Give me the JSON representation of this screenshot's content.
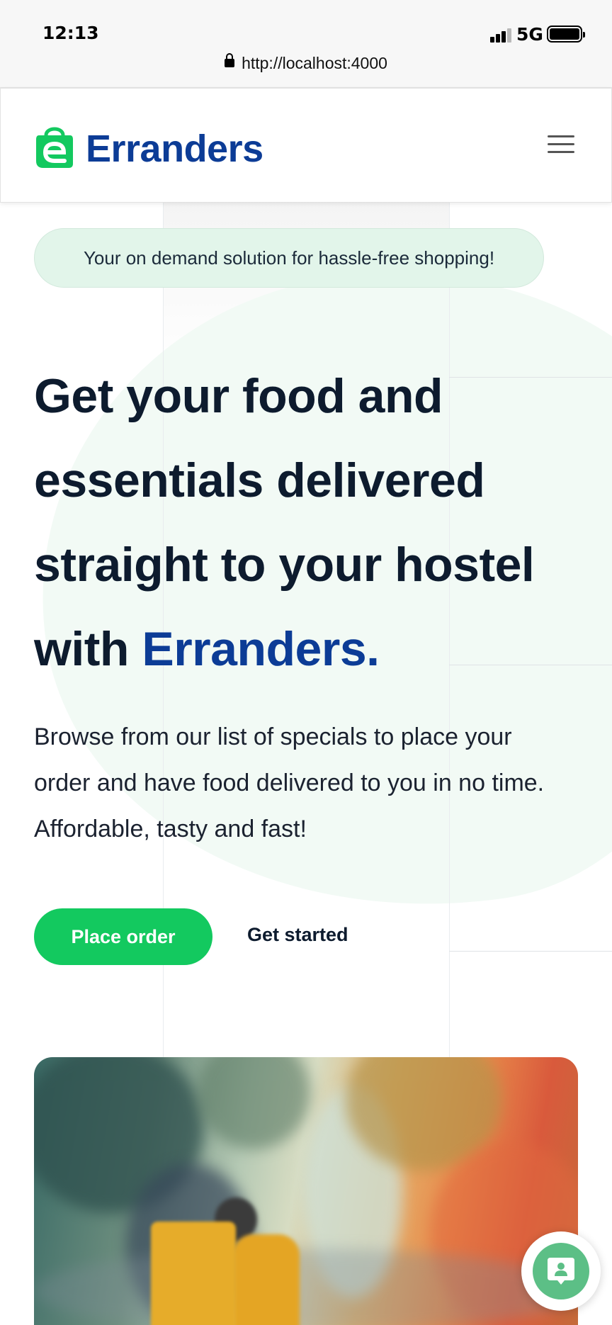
{
  "status_bar": {
    "time": "12:13",
    "network": "5G",
    "url": "http://localhost:4000"
  },
  "navbar": {
    "brand": "Erranders",
    "menu_icon": "hamburger-menu-icon",
    "logo_icon": "shopping-bag-logo-icon"
  },
  "hero": {
    "tagline": "Your on demand solution for hassle-free shopping!",
    "headline_lines": [
      "Get your food and",
      "essentials delivered",
      "straight to your hostel"
    ],
    "headline_last_prefix": "with ",
    "headline_accent": "Erranders.",
    "body": "Browse from our list of specials to place your order and have food delivered to you in no time. Affordable, tasty and fast!",
    "primary_button": "Place order",
    "secondary_button": "Get started"
  },
  "chat": {
    "icon": "chat-support-icon"
  },
  "colors": {
    "brand_blue": "#0c3c96",
    "brand_green": "#13c95f",
    "pill_bg": "#e2f5ea",
    "text_dark": "#0d1b2e"
  }
}
